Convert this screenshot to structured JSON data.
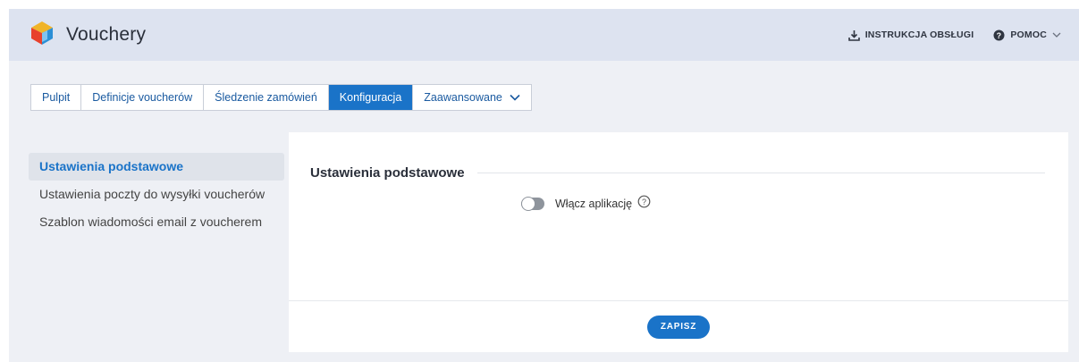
{
  "app": {
    "title": "Vouchery",
    "logo_icon": "cube-logo-icon"
  },
  "header": {
    "manual_label": "INSTRUKCJA OBSŁUGI",
    "manual_icon": "download-icon",
    "help_label": "POMOC",
    "help_icon": "question-circle-icon"
  },
  "tabs": [
    {
      "label": "Pulpit",
      "active": false
    },
    {
      "label": "Definicje voucherów",
      "active": false
    },
    {
      "label": "Śledzenie zamówień",
      "active": false
    },
    {
      "label": "Konfiguracja",
      "active": true
    },
    {
      "label": "Zaawansowane",
      "active": false,
      "dropdown": true
    }
  ],
  "sidebar": {
    "items": [
      {
        "label": "Ustawienia podstawowe",
        "active": true
      },
      {
        "label": "Ustawienia poczty do wysyłki voucherów",
        "active": false
      },
      {
        "label": "Szablon wiadomości email z voucherem",
        "active": false
      }
    ]
  },
  "panel": {
    "title": "Ustawienia podstawowe",
    "toggle_label": "Włącz aplikację",
    "toggle_on": false,
    "save_label": "ZAPISZ"
  },
  "colors": {
    "accent": "#1a73c8",
    "header_bg": "#dde3f0",
    "page_bg": "#eef0f5"
  }
}
